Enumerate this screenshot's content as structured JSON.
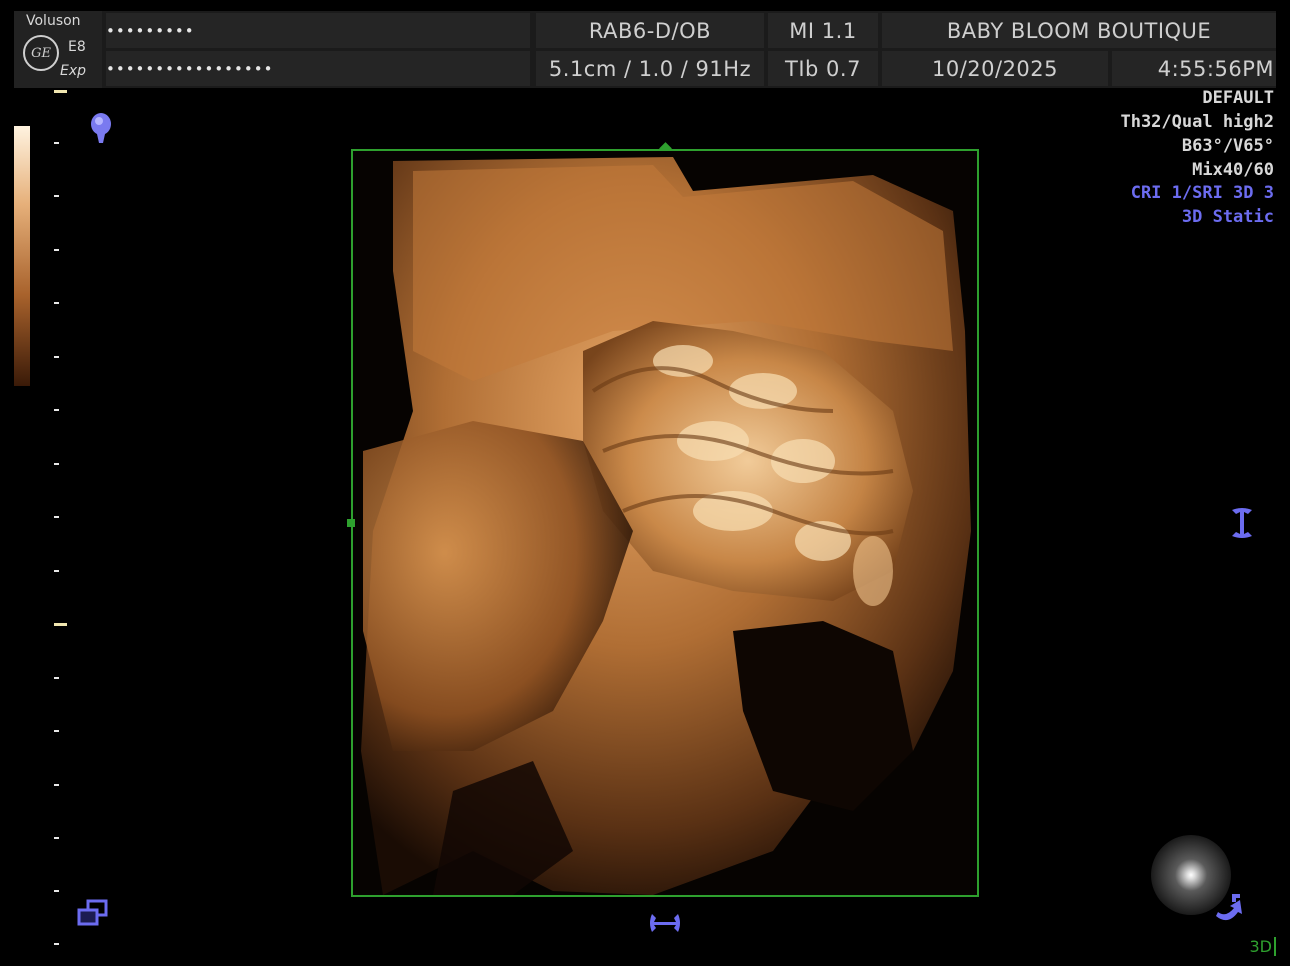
{
  "header": {
    "brand": "Voluson",
    "logo": "GE",
    "model": "E8",
    "mode": "Exp",
    "patient_name_masked": "•••••••••",
    "patient_id_masked": "•••••••••••••••••",
    "probe": "RAB6-D/OB",
    "mi": "MI 1.1",
    "institution": "BABY BLOOM BOUTIQUE",
    "depth_freq": "5.1cm / 1.0 / 91Hz",
    "tib": "TIb 0.7",
    "date": "10/20/2025",
    "time": "4:55:56PM"
  },
  "settings": {
    "preset": "DEFAULT",
    "quality": "Th32/Qual high2",
    "angles": "B63°/V65°",
    "mix": "Mix40/60",
    "cri": "CRI 1/SRI 3D 3",
    "render_mode": "3D Static"
  },
  "footer": {
    "mode_label": "3D"
  },
  "icons": {
    "probe_marker": "lightbulb-marker-icon",
    "layers": "layers-icon",
    "rotate_x": "rotate-vertical-icon",
    "rotate_y": "rotate-horizontal-icon",
    "light_ball": "light-source-ball-icon",
    "rotate_z": "rotate-z-icon"
  },
  "colors": {
    "roi_border": "#2ea02e",
    "overlay_blue": "#6c6cf0",
    "render_tint": "#c8843f"
  }
}
